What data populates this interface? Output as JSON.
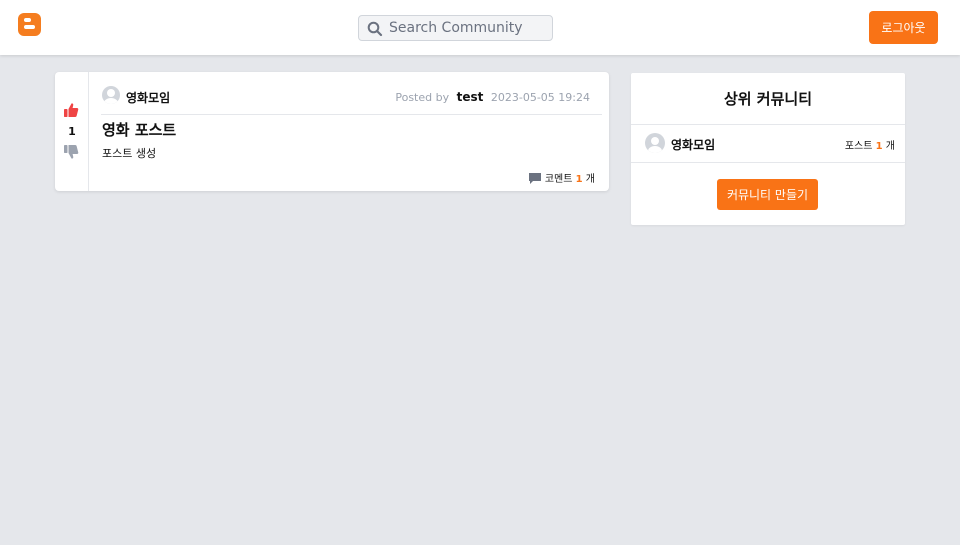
{
  "header": {
    "logo_icon": "blogger-logo-icon",
    "search": {
      "placeholder": "Search Community",
      "value": ""
    },
    "logout_label": "로그아웃"
  },
  "posts": [
    {
      "votes": {
        "count": "1",
        "upvoted": true
      },
      "community": "영화모임",
      "posted_by_label": "Posted by",
      "author": "test",
      "timestamp": "2023-05-05 19:24",
      "title": "영화 포스트",
      "body": "포스트 생성",
      "comments": {
        "label": "코멘트",
        "count": "1",
        "unit": "개"
      }
    }
  ],
  "sidebar": {
    "title": "상위 커뮤니티",
    "communities": [
      {
        "name": "영화모임",
        "posts_label": "포스트",
        "posts_count": "1",
        "posts_unit": "개"
      }
    ],
    "create_label": "커뮤니티 만들기"
  },
  "colors": {
    "accent": "#f97316",
    "upvote": "#ef4444",
    "background": "#e5e7eb"
  }
}
